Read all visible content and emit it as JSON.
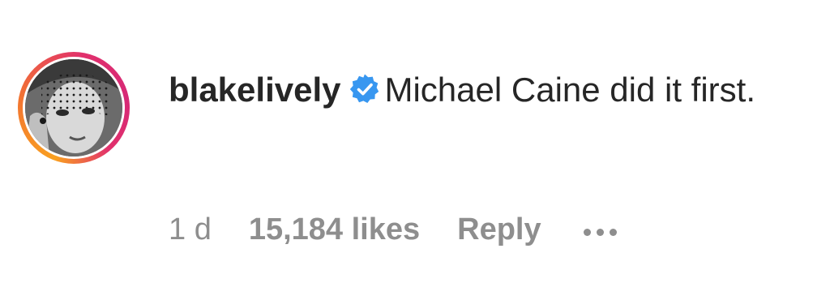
{
  "comment": {
    "username": "blakelively",
    "verified_icon": "verified-badge-icon",
    "text_line": "Michael Caine did it first.",
    "time_ago": "1 d",
    "likes": "15,184 likes",
    "reply_label": "Reply",
    "more_icon": "more-options-icon"
  },
  "colors": {
    "text": "#262626",
    "secondary": "#8e8e8e",
    "verified": "#3897f0",
    "ring_start": "#f9a020",
    "ring_end": "#d62976"
  }
}
